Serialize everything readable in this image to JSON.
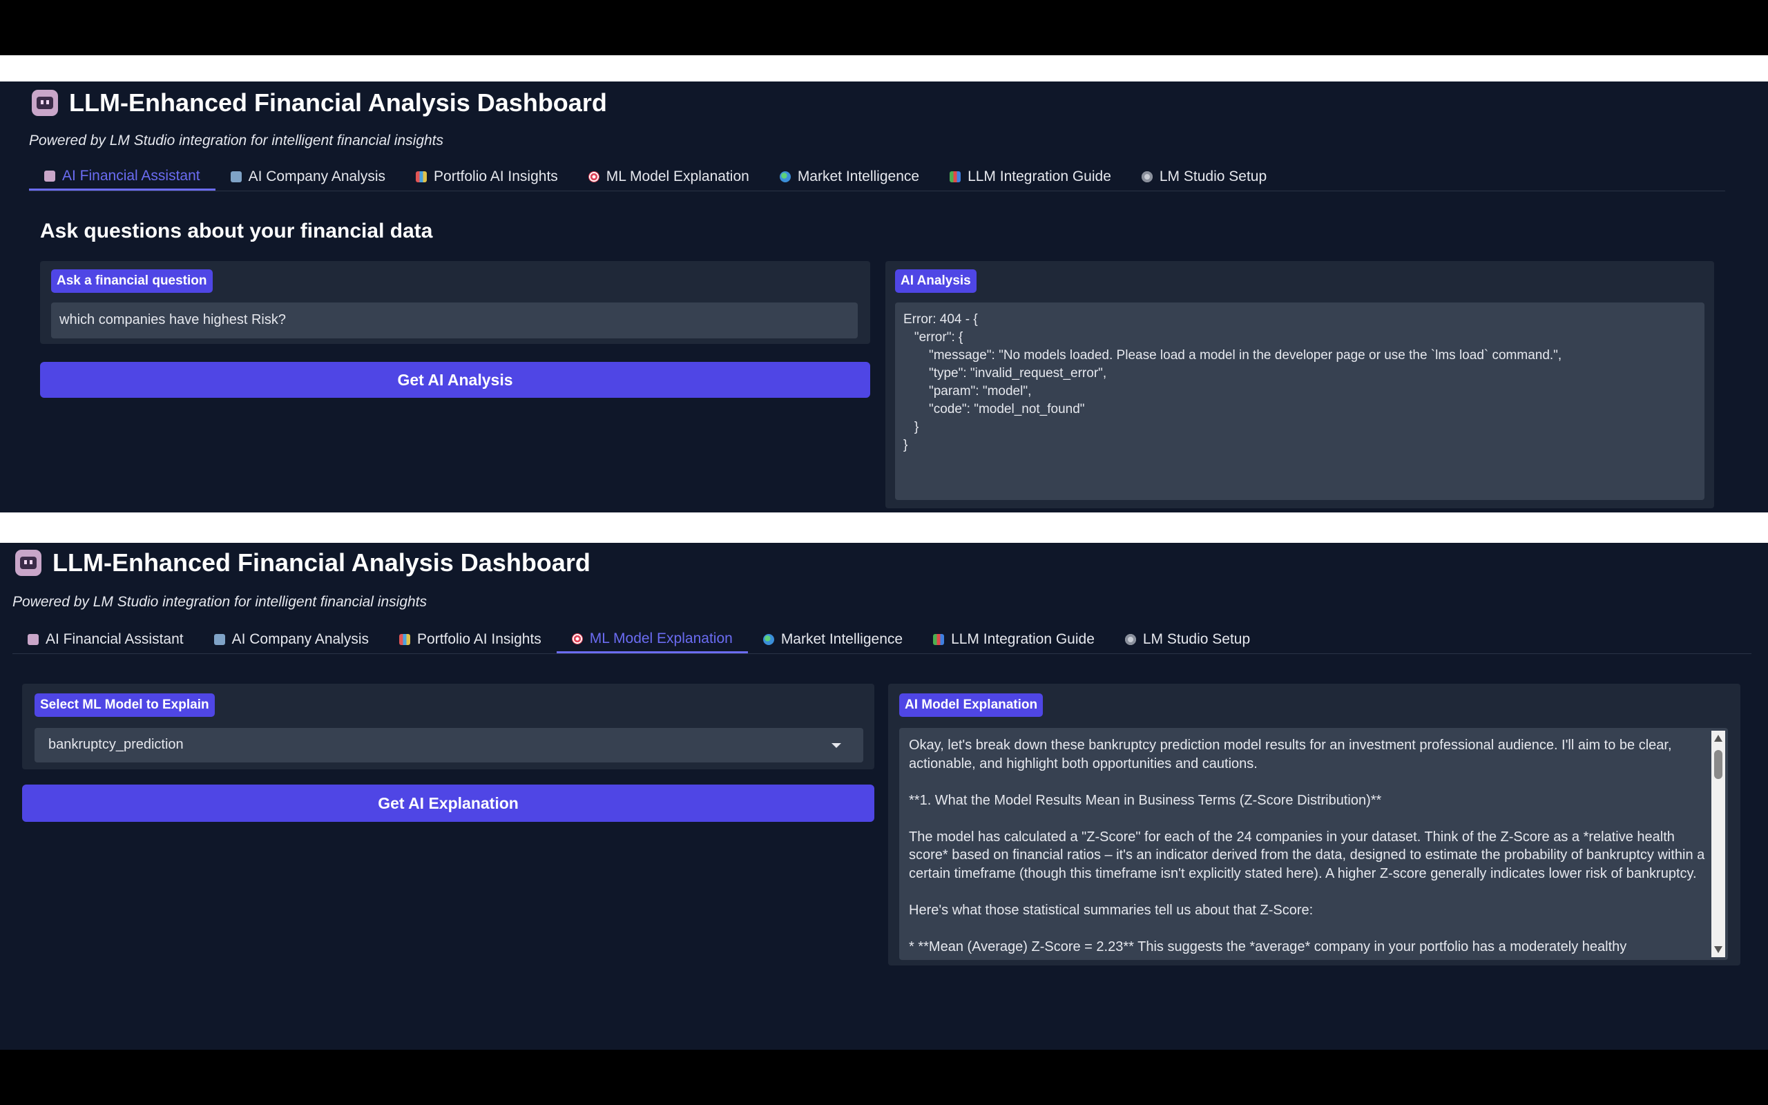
{
  "app": {
    "title": "LLM-Enhanced Financial Analysis Dashboard",
    "subtitle": "Powered by LM Studio integration for intelligent financial insights"
  },
  "tabs": [
    {
      "label": "AI Financial Assistant",
      "icon": "robot-icon"
    },
    {
      "label": "AI Company Analysis",
      "icon": "building-icon"
    },
    {
      "label": "Portfolio AI Insights",
      "icon": "bar-chart-icon"
    },
    {
      "label": "ML Model Explanation",
      "icon": "target-icon"
    },
    {
      "label": "Market Intelligence",
      "icon": "globe-icon"
    },
    {
      "label": "LLM Integration Guide",
      "icon": "books-icon"
    },
    {
      "label": "LM Studio Setup",
      "icon": "gear-icon"
    }
  ],
  "screen1": {
    "active_tab": "AI Financial Assistant",
    "heading": "Ask questions about your financial data",
    "question_label": "Ask a financial question",
    "question_value": "which companies have highest Risk?",
    "button_label": "Get AI Analysis",
    "output_label": "AI Analysis",
    "output_text": "Error: 404 - {\n   \"error\": {\n       \"message\": \"No models loaded. Please load a model in the developer page or use the `lms load` command.\",\n       \"type\": \"invalid_request_error\",\n       \"param\": \"model\",\n       \"code\": \"model_not_found\"\n   }\n}"
  },
  "screen2": {
    "active_tab": "ML Model Explanation",
    "select_label": "Select ML Model to Explain",
    "select_value": "bankruptcy_prediction",
    "button_label": "Get AI Explanation",
    "output_label": "AI Model Explanation",
    "paragraphs": [
      "Okay, let's break down these bankruptcy prediction model results for an investment professional audience. I'll aim to be clear, actionable, and highlight both opportunities and cautions.",
      "**1. What the Model Results Mean in Business Terms (Z-Score Distribution)**",
      "The model has calculated a \"Z-Score\" for each of the 24 companies in your dataset.  Think of the Z-Score as a *relative health score* based on financial ratios – it's an indicator derived from the data, designed to estimate the probability of bankruptcy within a certain timeframe (though this timeframe isn't explicitly stated here). A higher Z-score generally indicates lower risk of bankruptcy.",
      "Here's what those statistical summaries tell us about that Z-Score:",
      "*   **Mean (Average) Z-Score = 2.23** This suggests the *average* company in your portfolio has a moderately healthy"
    ]
  },
  "colors": {
    "background": "#0f1729",
    "card": "#1f2838",
    "field": "#374151",
    "accent": "#4f46e5",
    "active_tab": "#6b6cf2"
  }
}
